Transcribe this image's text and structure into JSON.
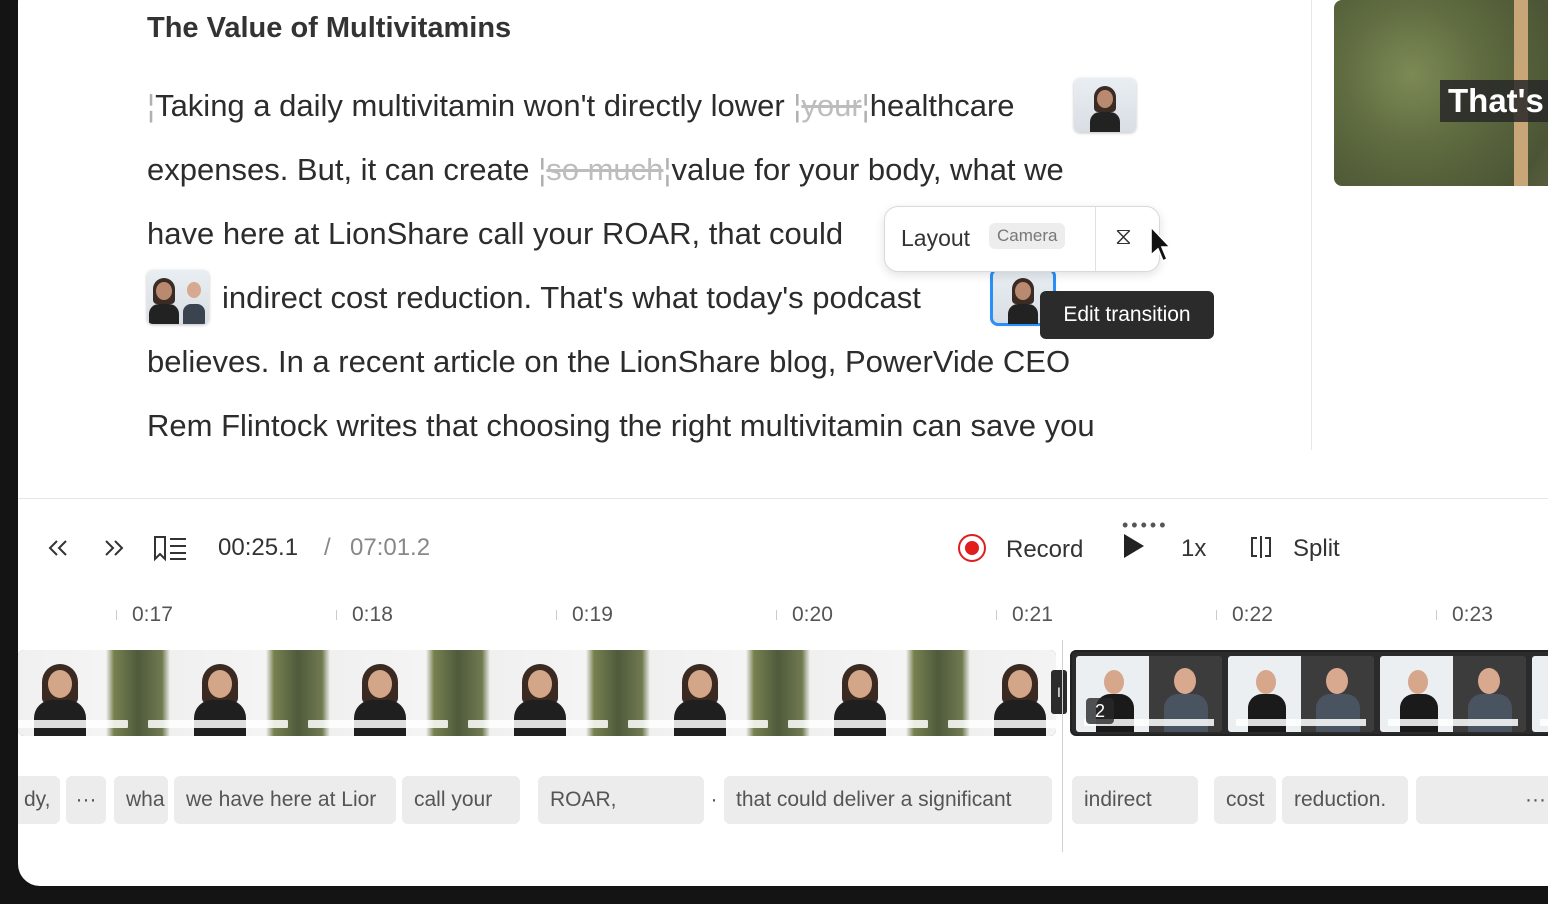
{
  "document": {
    "title": "The Value of Multivitamins",
    "line1_a": "Taking a daily multivitamin won't directly lower",
    "line1_struck": "your",
    "line1_b": "healthcare",
    "line2_a": "expenses. But, it can create",
    "line2_struck": "so much",
    "line2_b": "value for your body, what we",
    "line3": "have here at LionShare call your ROAR, that could",
    "line4": "indirect cost reduction. That's what today's podcast",
    "line5": "believes. In a recent article on the LionShare blog, PowerVide CEO",
    "line6": "Rem Flintock writes that choosing the right multivitamin can save you"
  },
  "preview": {
    "caption": "That's"
  },
  "layout_popover": {
    "label": "Layout",
    "value": "Camera",
    "icon": "hourglass-icon"
  },
  "tooltip": {
    "text": "Edit transition"
  },
  "transport": {
    "current_time": "00:25.1",
    "separator": "/",
    "total_time": "07:01.2",
    "record_label": "Record",
    "speed": "1x",
    "split_label": "Split",
    "icons": [
      "skip-back-icon",
      "skip-forward-icon",
      "chapters-icon",
      "record-icon",
      "play-icon",
      "split-icon"
    ]
  },
  "timeline": {
    "ticks": [
      "0:17",
      "0:18",
      "0:19",
      "0:20",
      "0:21",
      "0:22",
      "0:23"
    ],
    "scene_badge": "2",
    "cut_marker": "I",
    "words": [
      "dy,",
      "···",
      "wha",
      "we have here at Lior",
      "call your",
      "ROAR,",
      "·",
      "that could deliver a significant",
      "indirect",
      "cost",
      "reduction.",
      "···"
    ]
  },
  "colors": {
    "accent": "#2a8ff7",
    "record": "#e01e1e",
    "tooltip_bg": "#2b2b2b"
  }
}
